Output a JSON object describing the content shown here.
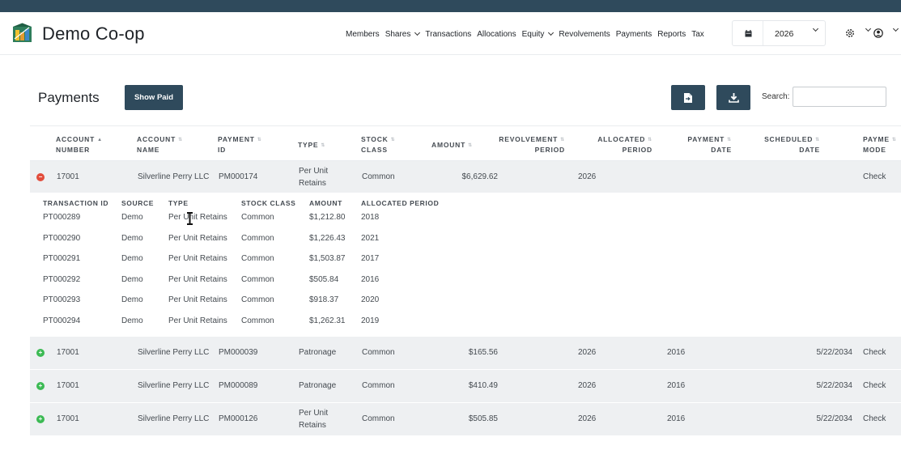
{
  "app": {
    "brand": "Demo Co-op",
    "nav": [
      {
        "label": "Members",
        "dropdown": false
      },
      {
        "label": "Shares",
        "dropdown": true
      },
      {
        "label": "Transactions",
        "dropdown": false
      },
      {
        "label": "Allocations",
        "dropdown": false
      },
      {
        "label": "Equity",
        "dropdown": true
      },
      {
        "label": "Revolvements",
        "dropdown": false
      },
      {
        "label": "Payments",
        "dropdown": false
      },
      {
        "label": "Reports",
        "dropdown": false
      },
      {
        "label": "Tax",
        "dropdown": false
      }
    ],
    "year": "2026",
    "icons": {
      "calendar": "calendar-icon",
      "settings": "gear-icon",
      "user": "user-icon"
    }
  },
  "page": {
    "title": "Payments",
    "show_paid_label": "Show Paid",
    "export_icon": "file-export-icon",
    "download_icon": "download-icon",
    "search_label": "Search:",
    "search_value": ""
  },
  "table": {
    "columns": [
      {
        "line1": "ACCOUNT",
        "line2": "NUMBER",
        "sort": "asc"
      },
      {
        "line1": "ACCOUNT",
        "line2": "NAME",
        "sort": "none"
      },
      {
        "line1": "PAYMENT",
        "line2": "ID",
        "sort": "none"
      },
      {
        "line1": "TYPE",
        "line2": "",
        "sort": "none"
      },
      {
        "line1": "STOCK",
        "line2": "CLASS",
        "sort": "none"
      },
      {
        "line1": "AMOUNT",
        "line2": "",
        "sort": "none"
      },
      {
        "line1": "REVOLVEMENT",
        "line2": "PERIOD",
        "sort": "none"
      },
      {
        "line1": "ALLOCATED",
        "line2": "PERIOD",
        "sort": "none"
      },
      {
        "line1": "PAYMENT",
        "line2": "DATE",
        "sort": "none"
      },
      {
        "line1": "SCHEDULED",
        "line2": "DATE",
        "sort": "none"
      },
      {
        "line1": "PAYME",
        "line2": "MODE",
        "sort": "none"
      }
    ],
    "rows": [
      {
        "expanded": true,
        "account_number": "17001",
        "account_name": "Silverline Perry LLC",
        "payment_id": "PM000174",
        "type": "Per Unit Retains",
        "stock_class": "Common",
        "amount": "$6,629.62",
        "revolvement_period": "2026",
        "allocated_period": "",
        "payment_date": "",
        "scheduled_date": "",
        "payment_mode": "Check"
      },
      {
        "expanded": false,
        "account_number": "17001",
        "account_name": "Silverline Perry LLC",
        "payment_id": "PM000039",
        "type": "Patronage",
        "stock_class": "Common",
        "amount": "$165.56",
        "revolvement_period": "2026",
        "allocated_period": "2016",
        "payment_date": "",
        "scheduled_date": "5/22/2034",
        "payment_mode": "Check"
      },
      {
        "expanded": false,
        "account_number": "17001",
        "account_name": "Silverline Perry LLC",
        "payment_id": "PM000089",
        "type": "Patronage",
        "stock_class": "Common",
        "amount": "$410.49",
        "revolvement_period": "2026",
        "allocated_period": "2016",
        "payment_date": "",
        "scheduled_date": "5/22/2034",
        "payment_mode": "Check"
      },
      {
        "expanded": false,
        "account_number": "17001",
        "account_name": "Silverline Perry LLC",
        "payment_id": "PM000126",
        "type": "Per Unit Retains",
        "stock_class": "Common",
        "amount": "$505.85",
        "revolvement_period": "2026",
        "allocated_period": "2016",
        "payment_date": "",
        "scheduled_date": "5/22/2034",
        "payment_mode": "Check"
      }
    ]
  },
  "detail": {
    "columns": [
      "TRANSACTION ID",
      "SOURCE",
      "TYPE",
      "STOCK CLASS",
      "AMOUNT",
      "ALLOCATED PERIOD"
    ],
    "rows": [
      {
        "transaction_id": "PT000289",
        "source": "Demo",
        "type": "Per Unit Retains",
        "stock_class": "Common",
        "amount": "$1,212.80",
        "allocated_period": "2018"
      },
      {
        "transaction_id": "PT000290",
        "source": "Demo",
        "type": "Per Unit Retains",
        "stock_class": "Common",
        "amount": "$1,226.43",
        "allocated_period": "2021"
      },
      {
        "transaction_id": "PT000291",
        "source": "Demo",
        "type": "Per Unit Retains",
        "stock_class": "Common",
        "amount": "$1,503.87",
        "allocated_period": "2017"
      },
      {
        "transaction_id": "PT000292",
        "source": "Demo",
        "type": "Per Unit Retains",
        "stock_class": "Common",
        "amount": "$505.84",
        "allocated_period": "2016"
      },
      {
        "transaction_id": "PT000293",
        "source": "Demo",
        "type": "Per Unit Retains",
        "stock_class": "Common",
        "amount": "$918.37",
        "allocated_period": "2020"
      },
      {
        "transaction_id": "PT000294",
        "source": "Demo",
        "type": "Per Unit Retains",
        "stock_class": "Common",
        "amount": "$1,262.31",
        "allocated_period": "2019"
      }
    ]
  },
  "colors": {
    "primary": "#2f4a5c",
    "row_bg": "#eef0f2",
    "collapse": "#e24c3b",
    "expand": "#3cba54"
  }
}
